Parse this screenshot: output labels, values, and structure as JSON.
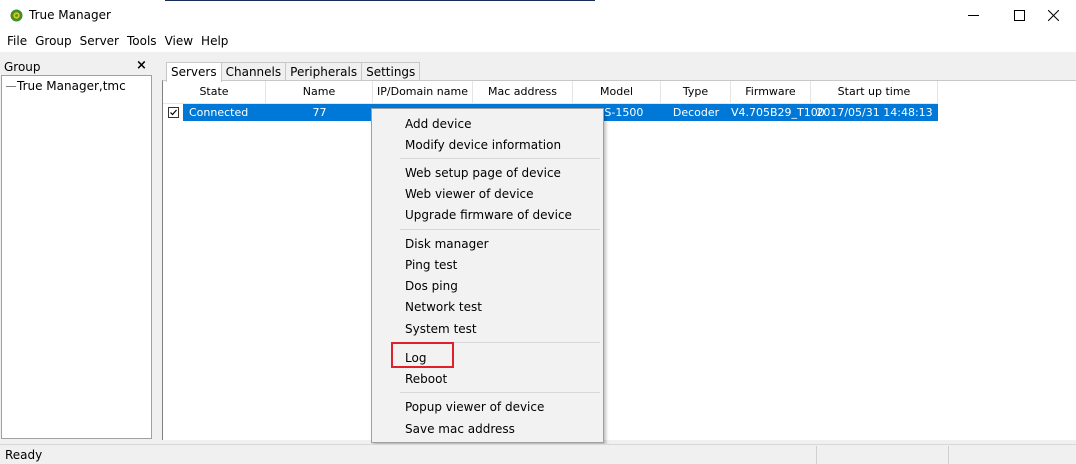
{
  "window": {
    "title": "True Manager"
  },
  "menu": [
    "File",
    "Group",
    "Server",
    "Tools",
    "View",
    "Help"
  ],
  "left_panel": {
    "title": "Group",
    "tree": [
      {
        "label": "True Manager,tmc"
      }
    ]
  },
  "tabs": [
    {
      "label": "Servers",
      "active": true
    },
    {
      "label": "Channels",
      "active": false
    },
    {
      "label": "Peripherals",
      "active": false
    },
    {
      "label": "Settings",
      "active": false
    }
  ],
  "columns": [
    "State",
    "Name",
    "IP/Domain name",
    "Mac address",
    "Model",
    "Type",
    "Firmware",
    "Start up time"
  ],
  "rows": [
    {
      "checked": true,
      "state": "Connected",
      "name": "77",
      "ip": "",
      "mac": "",
      "model": "TCS-1500",
      "type": "Decoder",
      "firmware": "V4.705B29_T100",
      "startup": "2017/05/31 14:48:13"
    }
  ],
  "context_menu": {
    "items": [
      "Add device",
      "Modify device information",
      "Web setup page of device",
      "Web viewer of device",
      "Upgrade firmware of device",
      "Disk manager",
      "Ping test",
      "Dos ping",
      "Network test",
      "System test",
      "Log",
      "Reboot",
      "Popup viewer of device",
      "Save mac address"
    ]
  },
  "status": {
    "text": "Ready"
  },
  "colors": {
    "selection": "#0078d7",
    "highlight_box": "#e0212b"
  }
}
